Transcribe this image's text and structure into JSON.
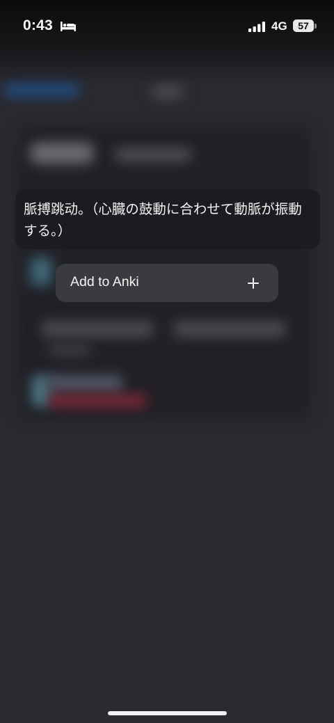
{
  "status_bar": {
    "time": "0:43",
    "network": "4G",
    "battery": "57"
  },
  "preview": {
    "text": "脈搏跳动。（心臓の鼓動に合わせて動脈が振動する。）"
  },
  "context_menu": {
    "items": [
      {
        "label": "Add to Anki",
        "icon": "plus-icon"
      }
    ]
  },
  "icons": {
    "status_mode": "bed-icon",
    "signal": "signal-icon"
  }
}
